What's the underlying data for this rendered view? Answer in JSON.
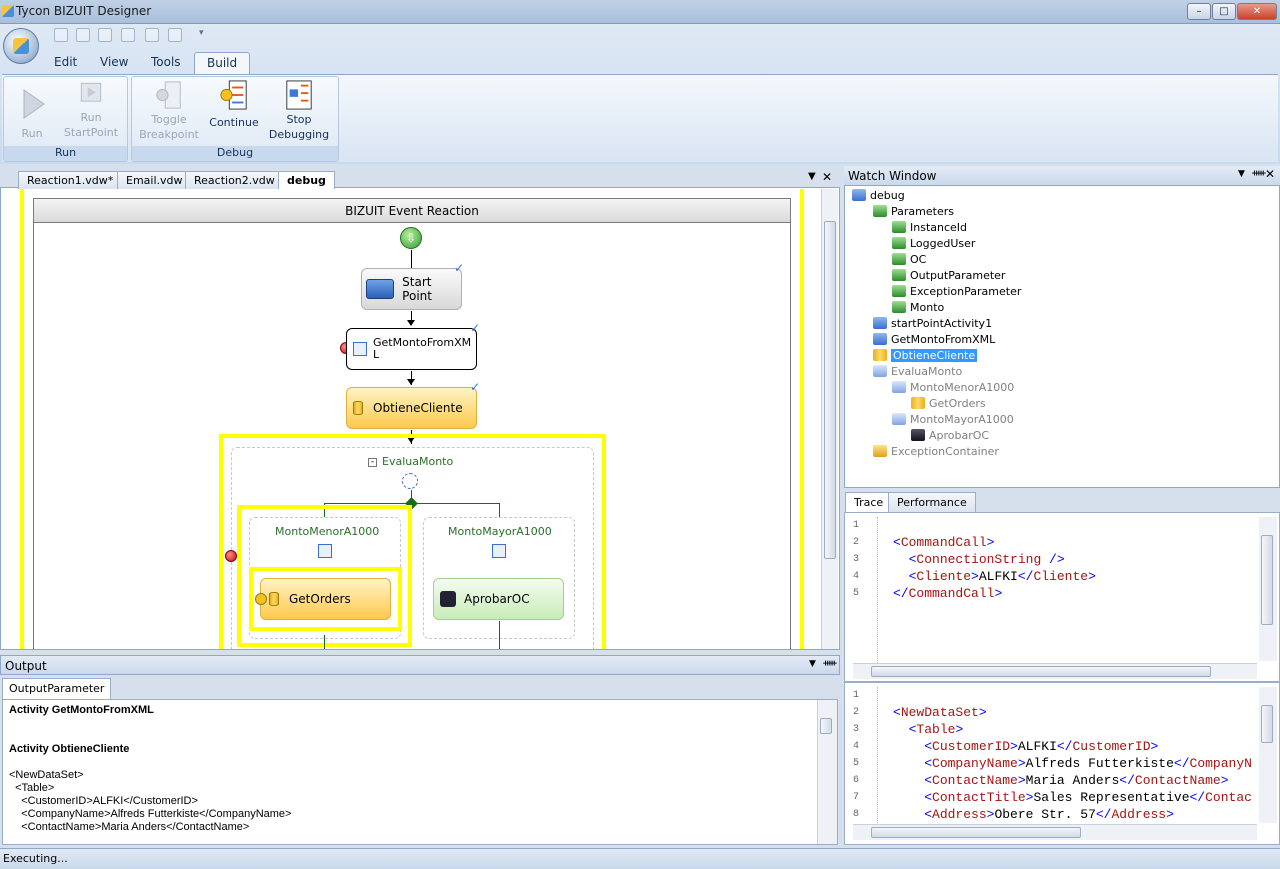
{
  "window": {
    "title": "Tycon BIZUIT Designer",
    "minimize": "–",
    "maximize": "□",
    "close": "✕"
  },
  "menu": {
    "tabs": [
      "Edit",
      "View",
      "Tools",
      "Build"
    ],
    "active": "Build"
  },
  "ribbon": {
    "groups": {
      "run": "Run",
      "debug": "Debug"
    },
    "buttons": {
      "run": "Run",
      "run_startpoint_1": "Run",
      "run_startpoint_2": "StartPoint",
      "toggle_1": "Toggle",
      "toggle_2": "Breakpoint",
      "continue": "Continue",
      "stop_1": "Stop",
      "stop_2": "Debugging"
    }
  },
  "doc_tabs": [
    "Reaction1.vdw*",
    "Email.vdw",
    "Reaction2.vdw",
    "debug"
  ],
  "workflow": {
    "header": "BIZUIT Event Reaction",
    "start_point": "Start Point",
    "get_monto_line1": "GetMontoFromXM",
    "get_monto_line2": "L",
    "obtiene_cliente": "ObtieneCliente",
    "evalua_monto": "EvaluaMonto",
    "branch_left": "MontoMenorA1000",
    "branch_right": "MontoMayorA1000",
    "get_orders": "GetOrders",
    "aprobar_oc": "AprobarOC"
  },
  "output": {
    "title": "Output",
    "tab": "OutputParameter",
    "lines": [
      "Activity GetMontoFromXML",
      "",
      "",
      "Activity ObtieneCliente",
      "",
      "<NewDataSet>",
      "  <Table>",
      "    <CustomerID>ALFKI</CustomerID>",
      "    <CompanyName>Alfreds Futterkiste</CompanyName>",
      "    <ContactName>Maria Anders</ContactName>"
    ]
  },
  "watch": {
    "title": "Watch Window",
    "items": [
      {
        "label": "debug",
        "indent": 0,
        "icon": "activity-icon",
        "grey": false
      },
      {
        "label": "Parameters",
        "indent": 1,
        "icon": "parameter-icon",
        "grey": false
      },
      {
        "label": "InstanceId",
        "indent": 2,
        "icon": "parameter-icon",
        "grey": false
      },
      {
        "label": "LoggedUser",
        "indent": 2,
        "icon": "parameter-icon",
        "grey": false
      },
      {
        "label": "OC",
        "indent": 2,
        "icon": "parameter-icon",
        "grey": false
      },
      {
        "label": "OutputParameter",
        "indent": 2,
        "icon": "parameter-icon",
        "grey": false
      },
      {
        "label": "ExceptionParameter",
        "indent": 2,
        "icon": "parameter-icon",
        "grey": false
      },
      {
        "label": "Monto",
        "indent": 2,
        "icon": "parameter-icon",
        "grey": false
      },
      {
        "label": "startPointActivity1",
        "indent": 1,
        "icon": "activity-icon",
        "grey": false
      },
      {
        "label": "GetMontoFromXML",
        "indent": 1,
        "icon": "activity-icon",
        "grey": false
      },
      {
        "label": "ObtieneCliente",
        "indent": 1,
        "icon": "database-icon",
        "grey": false,
        "selected": true
      },
      {
        "label": "EvaluaMonto",
        "indent": 1,
        "icon": "branch-icon",
        "grey": true
      },
      {
        "label": "MontoMenorA1000",
        "indent": 2,
        "icon": "branch-icon",
        "grey": true
      },
      {
        "label": "GetOrders",
        "indent": 3,
        "icon": "database-icon",
        "grey": true
      },
      {
        "label": "MontoMayorA1000",
        "indent": 2,
        "icon": "branch-icon",
        "grey": true
      },
      {
        "label": "AprobarOC",
        "indent": 3,
        "icon": "approve-icon",
        "grey": true
      },
      {
        "label": "ExceptionContainer",
        "indent": 1,
        "icon": "exception-icon",
        "grey": true
      }
    ]
  },
  "trace": {
    "tabs": [
      "Trace",
      "Performance"
    ],
    "active": "Trace",
    "top": {
      "line_numbers": [
        "1",
        "2",
        "3",
        "4",
        "5"
      ],
      "lines": [
        "",
        "<CommandCall>",
        "  <ConnectionString />",
        "  <Cliente>ALFKI</Cliente>",
        "</CommandCall>"
      ]
    },
    "bottom": {
      "line_numbers": [
        "1",
        "2",
        "3",
        "4",
        "5",
        "6",
        "7",
        "8"
      ],
      "lines": [
        "",
        "<NewDataSet>",
        "  <Table>",
        "    <CustomerID>ALFKI</CustomerID>",
        "    <CompanyName>Alfreds Futterkiste</CompanyN",
        "    <ContactName>Maria Anders</ContactName>",
        "    <ContactTitle>Sales Representative</Contac",
        "    <Address>Obere Str. 57</Address>"
      ]
    }
  },
  "status": {
    "text": "Executing..."
  },
  "colors": {
    "highlight": "#ffff00",
    "selection": "#3399ff",
    "tag": "#0000ff",
    "tag_name": "#a31515"
  }
}
